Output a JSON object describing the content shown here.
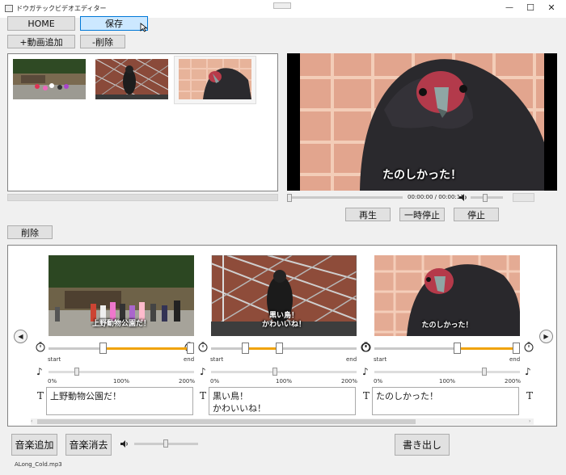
{
  "window": {
    "title": "ドウガテックビデオエディター",
    "controls": {
      "minimize": "—",
      "maximize": "☐",
      "close": "✕"
    }
  },
  "toolbar": {
    "home_label": "HOME",
    "save_label": "保存",
    "add_video_label": "+動画追加",
    "remove_label": "-削除"
  },
  "library": {
    "thumbnails": [
      {
        "name": "zoo-crowd",
        "selected": false
      },
      {
        "name": "black-bird",
        "selected": false
      },
      {
        "name": "eagle-closeup",
        "selected": true
      }
    ]
  },
  "preview": {
    "subtitle": "たのしかった！",
    "time": "00:00:00 / 00:00:11",
    "playback_fraction": 0.0,
    "volume_fraction": 0.6,
    "play_label": "再生",
    "pause_label": "一時停止",
    "stop_label": "停止"
  },
  "timeline": {
    "delete_label": "削除",
    "clips": [
      {
        "subtitle": "上野動物公園だ！",
        "text": "上野動物公園だ！",
        "start_label": "start",
        "end_label": "end",
        "trim_start": 0.0,
        "trim_handle_a": 0.4,
        "trim_handle_b": 1.0,
        "volume_percent": 50,
        "vol_min": "0%",
        "vol_mid": "100%",
        "vol_max": "200%"
      },
      {
        "subtitle": "黒い鳥！\nかわいいね！",
        "text": "黒い鳥！\nかわいいね！",
        "start_label": "start",
        "end_label": "end",
        "trim_handle_a": 0.24,
        "trim_handle_b": 0.47,
        "volume_percent": 100,
        "vol_min": "0%",
        "vol_mid": "100%",
        "vol_max": "200%"
      },
      {
        "subtitle": "たのしかった！",
        "text": "たのしかった！",
        "start_label": "start",
        "end_label": "end",
        "trim_handle_a": 0.58,
        "trim_handle_b": 1.0,
        "volume_percent": 150,
        "vol_min": "0%",
        "vol_mid": "100%",
        "vol_max": "200%"
      }
    ]
  },
  "bottom": {
    "add_music_label": "音楽追加",
    "remove_music_label": "音楽消去",
    "export_label": "書き出し",
    "music_file": "ALong_Cold.mp3",
    "music_volume_fraction": 0.5
  },
  "colors": {
    "accent_orange": "#f0a30a",
    "selected_button": "#cce8ff",
    "selected_border": "#0078d7"
  }
}
